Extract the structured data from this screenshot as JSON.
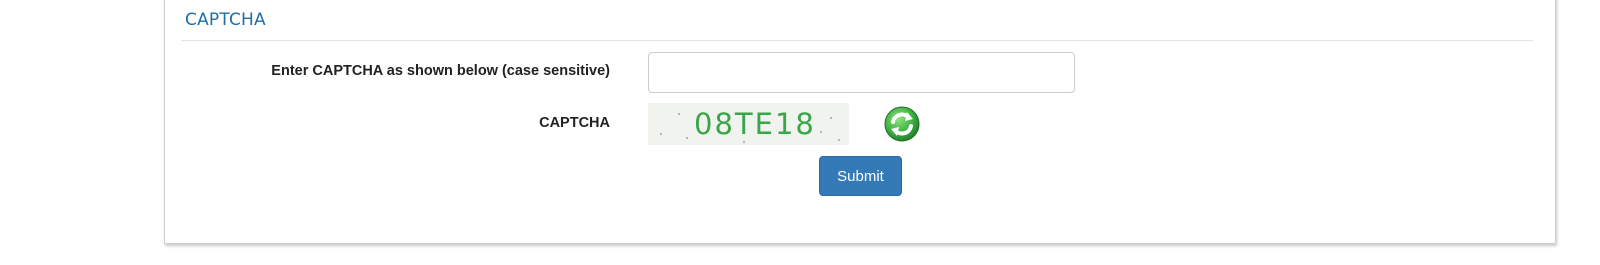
{
  "section": {
    "title": "CAPTCHA"
  },
  "form": {
    "input_label": "Enter CAPTCHA as shown below (case sensitive)",
    "input_value": "",
    "captcha_label": "CAPTCHA",
    "captcha_code": "08TE18",
    "refresh_icon": "refresh-icon",
    "submit_label": "Submit"
  },
  "colors": {
    "title": "#1f6fa5",
    "captcha_text": "#3aa64a",
    "captcha_bg": "#f1f3ef",
    "submit_bg": "#337ab7",
    "refresh_green": "#2e9b3a"
  }
}
